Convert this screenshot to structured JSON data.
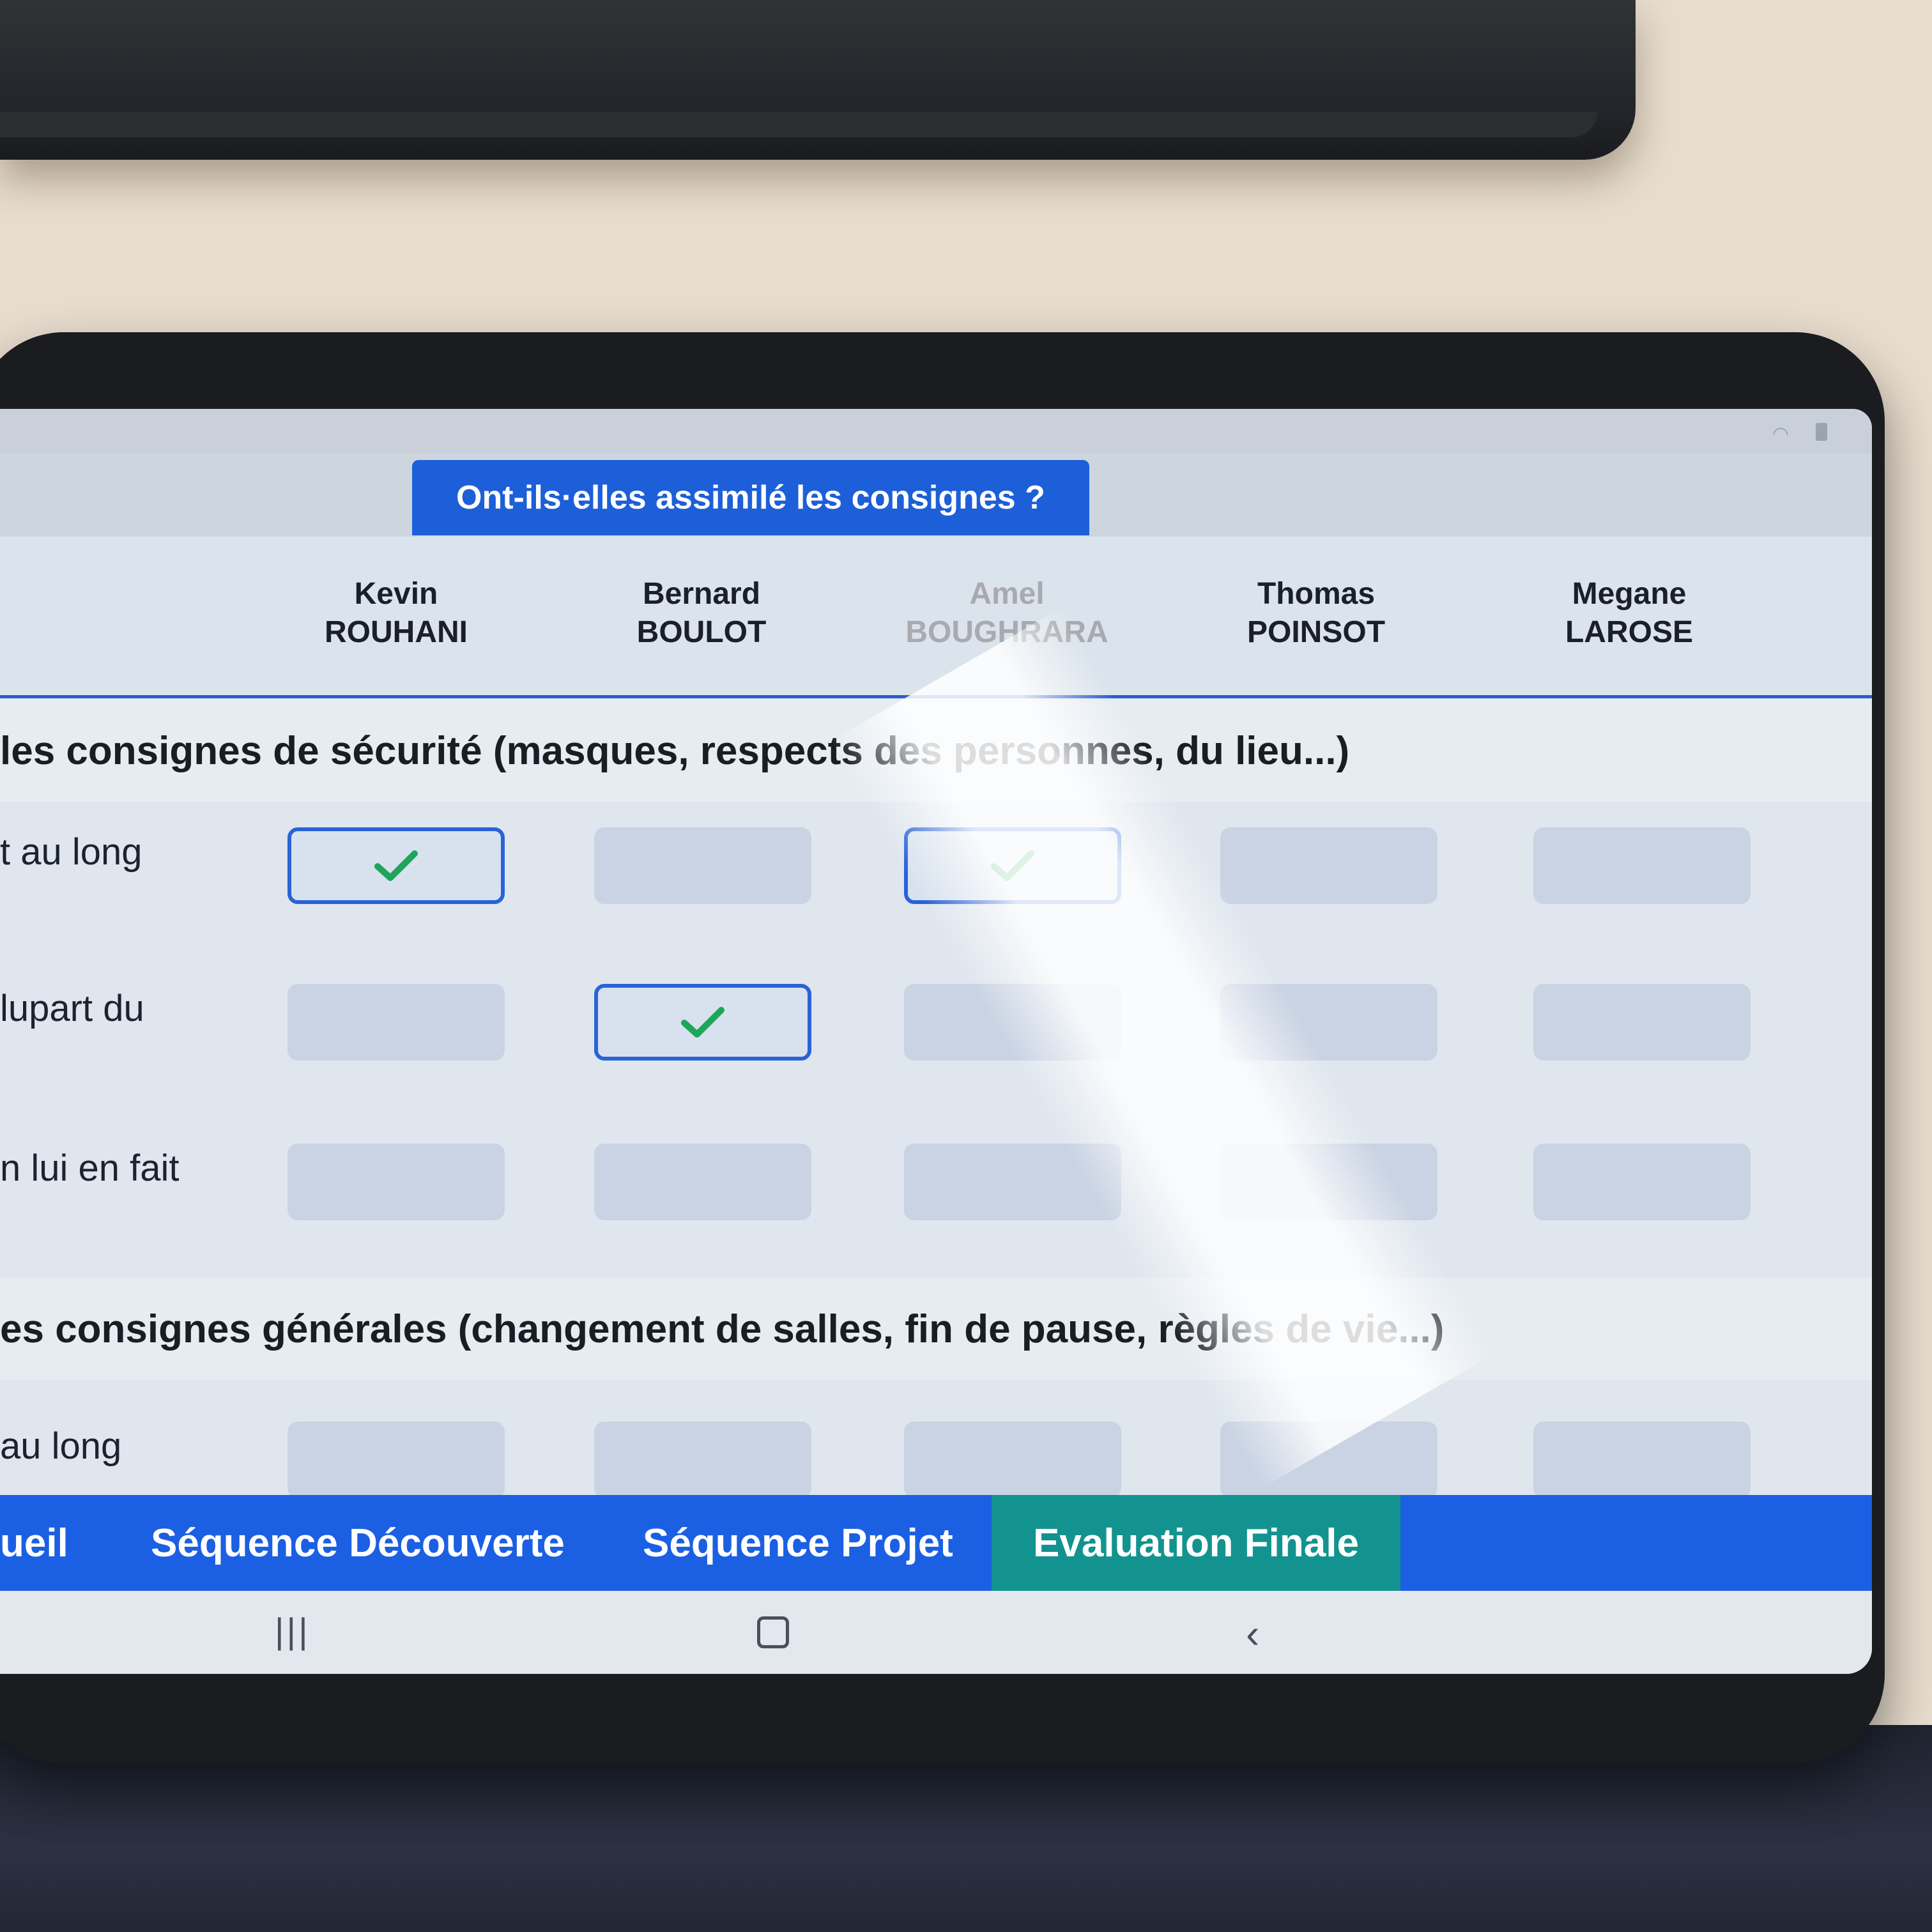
{
  "header": {
    "question": "Ont-ils·elles assimilé les consignes ?"
  },
  "students": [
    {
      "first": "Kevin",
      "last": "ROUHANI"
    },
    {
      "first": "Bernard",
      "last": "BOULOT"
    },
    {
      "first": "Amel",
      "last": "BOUGHRARA"
    },
    {
      "first": "Thomas",
      "last": "POINSOT"
    },
    {
      "first": "Megane",
      "last": "LAROSE"
    }
  ],
  "sections": [
    {
      "title": "les consignes de sécurité (masques, respects des personnes, du lieu...)",
      "rows": [
        {
          "label": "t au long",
          "checked": [
            true,
            false,
            true,
            false,
            false
          ]
        },
        {
          "label": "lupart du",
          "checked": [
            false,
            true,
            false,
            false,
            false
          ]
        },
        {
          "label": "n lui en fait",
          "checked": [
            false,
            false,
            false,
            false,
            false
          ]
        }
      ]
    },
    {
      "title": "es consignes générales (changement de salles, fin de pause, règles de vie...)",
      "rows": [
        {
          "label": "au long",
          "checked": [
            false,
            false,
            false,
            false,
            false
          ]
        }
      ]
    }
  ],
  "nav": {
    "tabs": [
      {
        "label": "ueil",
        "active": false
      },
      {
        "label": "Séquence Découverte",
        "active": false
      },
      {
        "label": "Séquence Projet",
        "active": false
      },
      {
        "label": "Evaluation Finale",
        "active": true
      }
    ]
  },
  "system_nav": {
    "recents": "|||",
    "back": "‹"
  },
  "colors": {
    "primary": "#1b5fe3",
    "active_tab": "#13938f",
    "check": "#1fa55a"
  }
}
